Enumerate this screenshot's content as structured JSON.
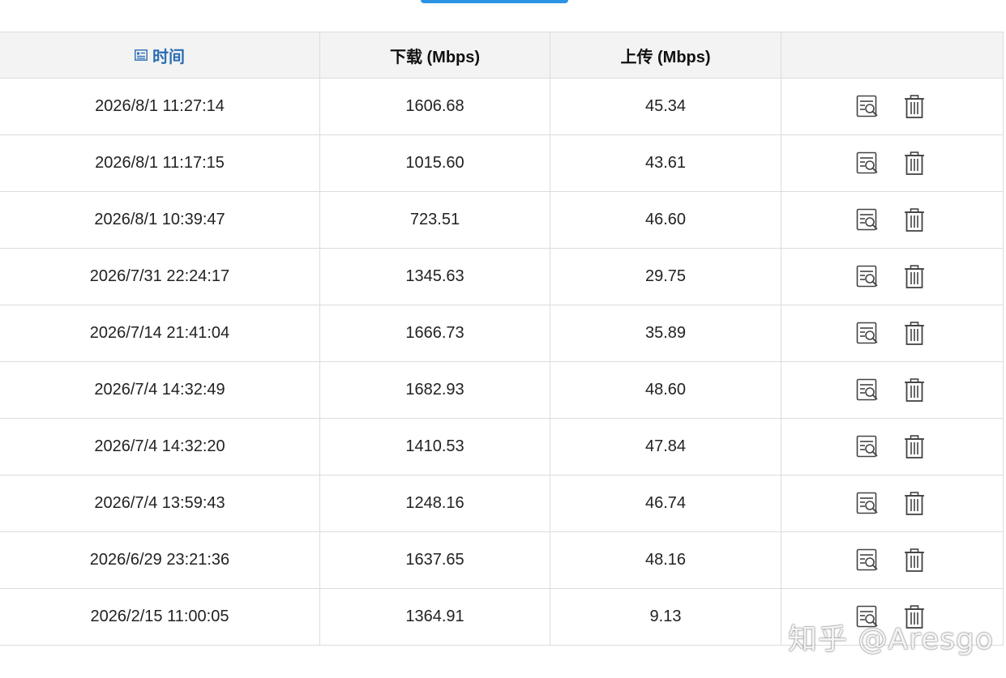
{
  "header": {
    "time": "时间",
    "download": "下载 (Mbps)",
    "upload": "上传 (Mbps)",
    "actions": ""
  },
  "rows": [
    {
      "time": "2026/8/1 11:27:14",
      "download": "1606.68",
      "upload": "45.34"
    },
    {
      "time": "2026/8/1 11:17:15",
      "download": "1015.60",
      "upload": "43.61"
    },
    {
      "time": "2026/8/1 10:39:47",
      "download": "723.51",
      "upload": "46.60"
    },
    {
      "time": "2026/7/31 22:24:17",
      "download": "1345.63",
      "upload": "29.75"
    },
    {
      "time": "2026/7/14 21:41:04",
      "download": "1666.73",
      "upload": "35.89"
    },
    {
      "time": "2026/7/4 14:32:49",
      "download": "1682.93",
      "upload": "48.60"
    },
    {
      "time": "2026/7/4 14:32:20",
      "download": "1410.53",
      "upload": "47.84"
    },
    {
      "time": "2026/7/4 13:59:43",
      "download": "1248.16",
      "upload": "46.74"
    },
    {
      "time": "2026/6/29 23:21:36",
      "download": "1637.65",
      "upload": "48.16"
    },
    {
      "time": "2026/2/15 11:00:05",
      "download": "1364.91",
      "upload": "9.13"
    }
  ],
  "icons": {
    "sort": "list-sort-icon",
    "view": "view-details-icon",
    "delete": "trash-icon"
  },
  "colors": {
    "accent": "#2a93e4",
    "header_link": "#2a6db5",
    "header_bg": "#f3f3f3",
    "border": "#dcdcdc"
  },
  "watermark": "知乎 @Aresgo"
}
